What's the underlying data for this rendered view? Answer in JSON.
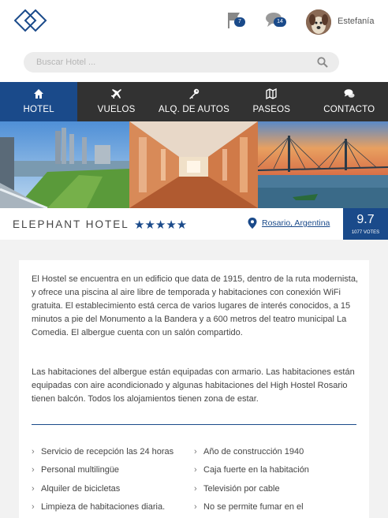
{
  "header": {
    "notification_count": "7",
    "message_count": "14",
    "username": "Estefanía"
  },
  "search": {
    "placeholder": "Buscar Hotel ..."
  },
  "nav": {
    "items": [
      {
        "label": "HOTEL",
        "icon": "home-icon",
        "active": true
      },
      {
        "label": "VUELOS",
        "icon": "plane-icon",
        "active": false
      },
      {
        "label": "ALQ. DE AUTOS",
        "icon": "key-icon",
        "active": false
      },
      {
        "label": "PASEOS",
        "icon": "map-icon",
        "active": false
      },
      {
        "label": "CONTACTO",
        "icon": "chat-bubbles-icon",
        "active": false
      }
    ]
  },
  "hotel": {
    "name": "ELEPHANT HOTEL",
    "stars": "★★★★★",
    "rating_stars": 5,
    "location": "Rosario, Argentina",
    "score": "9.7",
    "votes": "1077 VOTES"
  },
  "description": {
    "p1": "El Hostel se encuentra en un edificio que data de 1915, dentro de la ruta modernista, y ofrece una piscina al aire libre de temporada y habitaciones con conexión WiFi gratuita. El establecimiento está cerca de varios lugares de interés conocidos, a 15 minutos a pie del Monumento a la Bandera y a 600 metros del teatro municipal La Comedia. El albergue cuenta con un salón compartido.",
    "p2": "Las habitaciones del albergue están equipadas con armario. Las habitaciones están equipadas con aire acondicionado y algunas habitaciones del High Hostel Rosario tienen balcón. Todos los alojamientos tienen zona de estar."
  },
  "amenities": {
    "left": [
      "Servicio de recepción las 24 horas",
      "Personal multilingüe",
      "Alquiler de bicicletas",
      "Limpieza de habitaciones diaria."
    ],
    "right": [
      "Año de construcción 1940",
      "Caja fuerte en la habitación",
      "Televisión por cable",
      "No se permite fumar en el"
    ]
  },
  "colors": {
    "primary": "#1a4a8a",
    "nav_bg": "#323232",
    "page_bg": "#f2f2f2"
  }
}
